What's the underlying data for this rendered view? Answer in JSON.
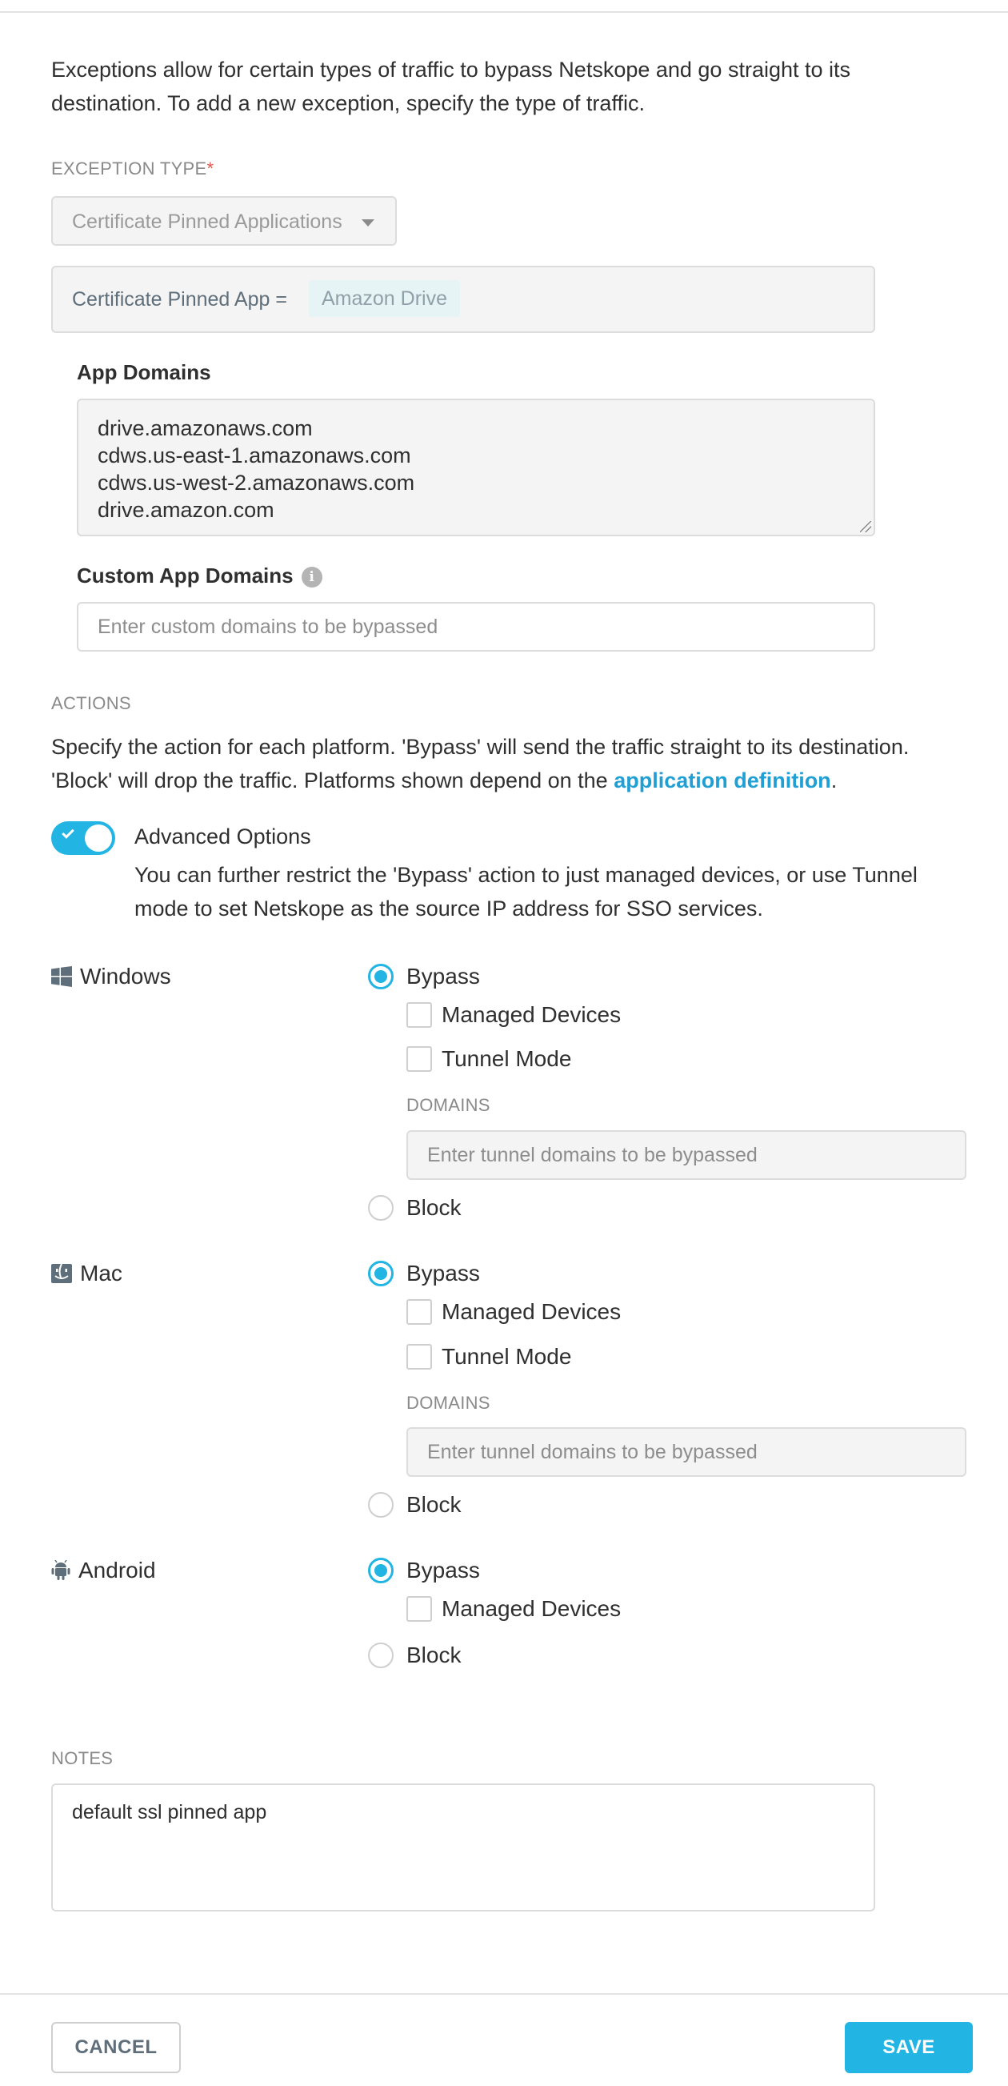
{
  "intro": "Exceptions allow for certain types of traffic to bypass Netskope and go straight to its destination. To add a new exception, specify the type of traffic.",
  "exception_type": {
    "label": "EXCEPTION TYPE",
    "required_mark": "*",
    "selected": "Certificate Pinned Applications"
  },
  "pinned_app": {
    "label": "Certificate Pinned App =",
    "value": "Amazon Drive"
  },
  "app_domains": {
    "heading": "App Domains",
    "lines": [
      "drive.amazonaws.com",
      "cdws.us-east-1.amazonaws.com",
      "cdws.us-west-2.amazonaws.com",
      "drive.amazon.com"
    ]
  },
  "custom_app_domains": {
    "heading": "Custom App Domains",
    "info_icon": "info-icon",
    "placeholder": "Enter custom domains to be bypassed"
  },
  "actions": {
    "label": "ACTIONS",
    "desc_before": "Specify the action for each platform. 'Bypass' will send the traffic straight to its destination. 'Block' will drop the traffic. Platforms shown depend on the ",
    "link": "application definition",
    "desc_after": "."
  },
  "advanced": {
    "enabled": true,
    "title": "Advanced Options",
    "desc": "You can further restrict the 'Bypass' action to just managed devices, or use Tunnel mode to set Netskope as the source IP address for SSO services."
  },
  "labels": {
    "bypass": "Bypass",
    "block": "Block",
    "managed": "Managed Devices",
    "tunnel": "Tunnel Mode",
    "domains": "DOMAINS",
    "tunnel_placeholder": "Enter tunnel domains to be bypassed"
  },
  "platforms": {
    "windows": {
      "name": "Windows",
      "icon": "windows-icon",
      "action": "Bypass"
    },
    "mac": {
      "name": "Mac",
      "icon": "finder-icon",
      "action": "Bypass"
    },
    "android": {
      "name": "Android",
      "icon": "android-icon",
      "action": "Bypass"
    }
  },
  "notes": {
    "label": "NOTES",
    "value": "default ssl pinned app"
  },
  "buttons": {
    "cancel": "CANCEL",
    "save": "SAVE"
  },
  "colors": {
    "accent": "#22b5e3",
    "link": "#1f9fd4",
    "required": "#e2554b"
  }
}
